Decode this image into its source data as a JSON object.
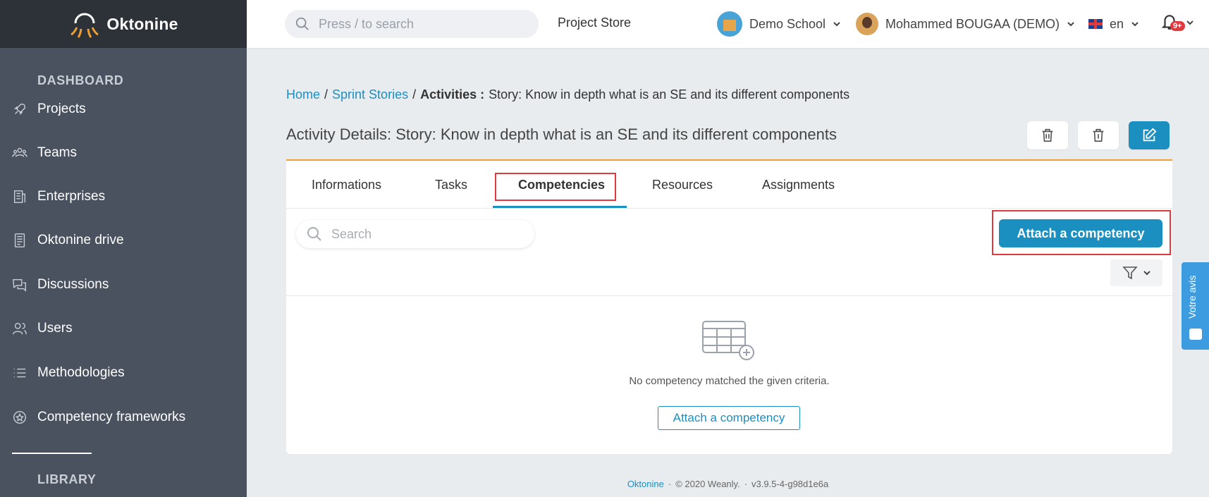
{
  "app": {
    "name": "Oktonine"
  },
  "sidebar": {
    "sections": [
      {
        "title": "DASHBOARD"
      },
      {
        "title": "LIBRARY"
      }
    ],
    "items": [
      {
        "label": "Projects",
        "icon": "rocket-icon"
      },
      {
        "label": "Teams",
        "icon": "team-icon"
      },
      {
        "label": "Enterprises",
        "icon": "building-icon"
      },
      {
        "label": "Oktonine drive",
        "icon": "drive-icon"
      },
      {
        "label": "Discussions",
        "icon": "chat-icon"
      },
      {
        "label": "Users",
        "icon": "users-icon"
      },
      {
        "label": "Methodologies",
        "icon": "list-icon"
      },
      {
        "label": "Competency frameworks",
        "icon": "badge-icon"
      }
    ]
  },
  "topbar": {
    "search_placeholder": "Press / to search",
    "project_store": "Project Store",
    "school": "Demo School",
    "user": "Mohammed BOUGAA (DEMO)",
    "language": "en",
    "notifications_badge": "9+"
  },
  "breadcrumb": {
    "home": "Home",
    "separator": "/",
    "sprint_stories": "Sprint Stories",
    "activities": "Activities :",
    "current": "Story: Know in depth what is an SE and its different components"
  },
  "page": {
    "title": "Activity Details: Story: Know in depth what is an SE and its different components"
  },
  "tabs": [
    {
      "label": "Informations"
    },
    {
      "label": "Tasks"
    },
    {
      "label": "Competencies",
      "active": true
    },
    {
      "label": "Resources"
    },
    {
      "label": "Assignments"
    }
  ],
  "competencies": {
    "search_placeholder": "Search",
    "attach_button": "Attach a competency",
    "empty_message": "No competency matched the given criteria.",
    "empty_attach_button": "Attach a competency"
  },
  "footer": {
    "brand": "Oktonine",
    "dot": "·",
    "copyright": "© 2020 Weanly.",
    "version": "v3.9.5-4-g98d1e6a"
  },
  "feedback": {
    "label": "Votre avis"
  },
  "colors": {
    "accent": "#1a8fc0",
    "sidebar_bg": "#4a5260",
    "sidebar_header_bg": "#2d3138",
    "highlight": "#e0393e",
    "card_top_border": "#f0a030"
  }
}
